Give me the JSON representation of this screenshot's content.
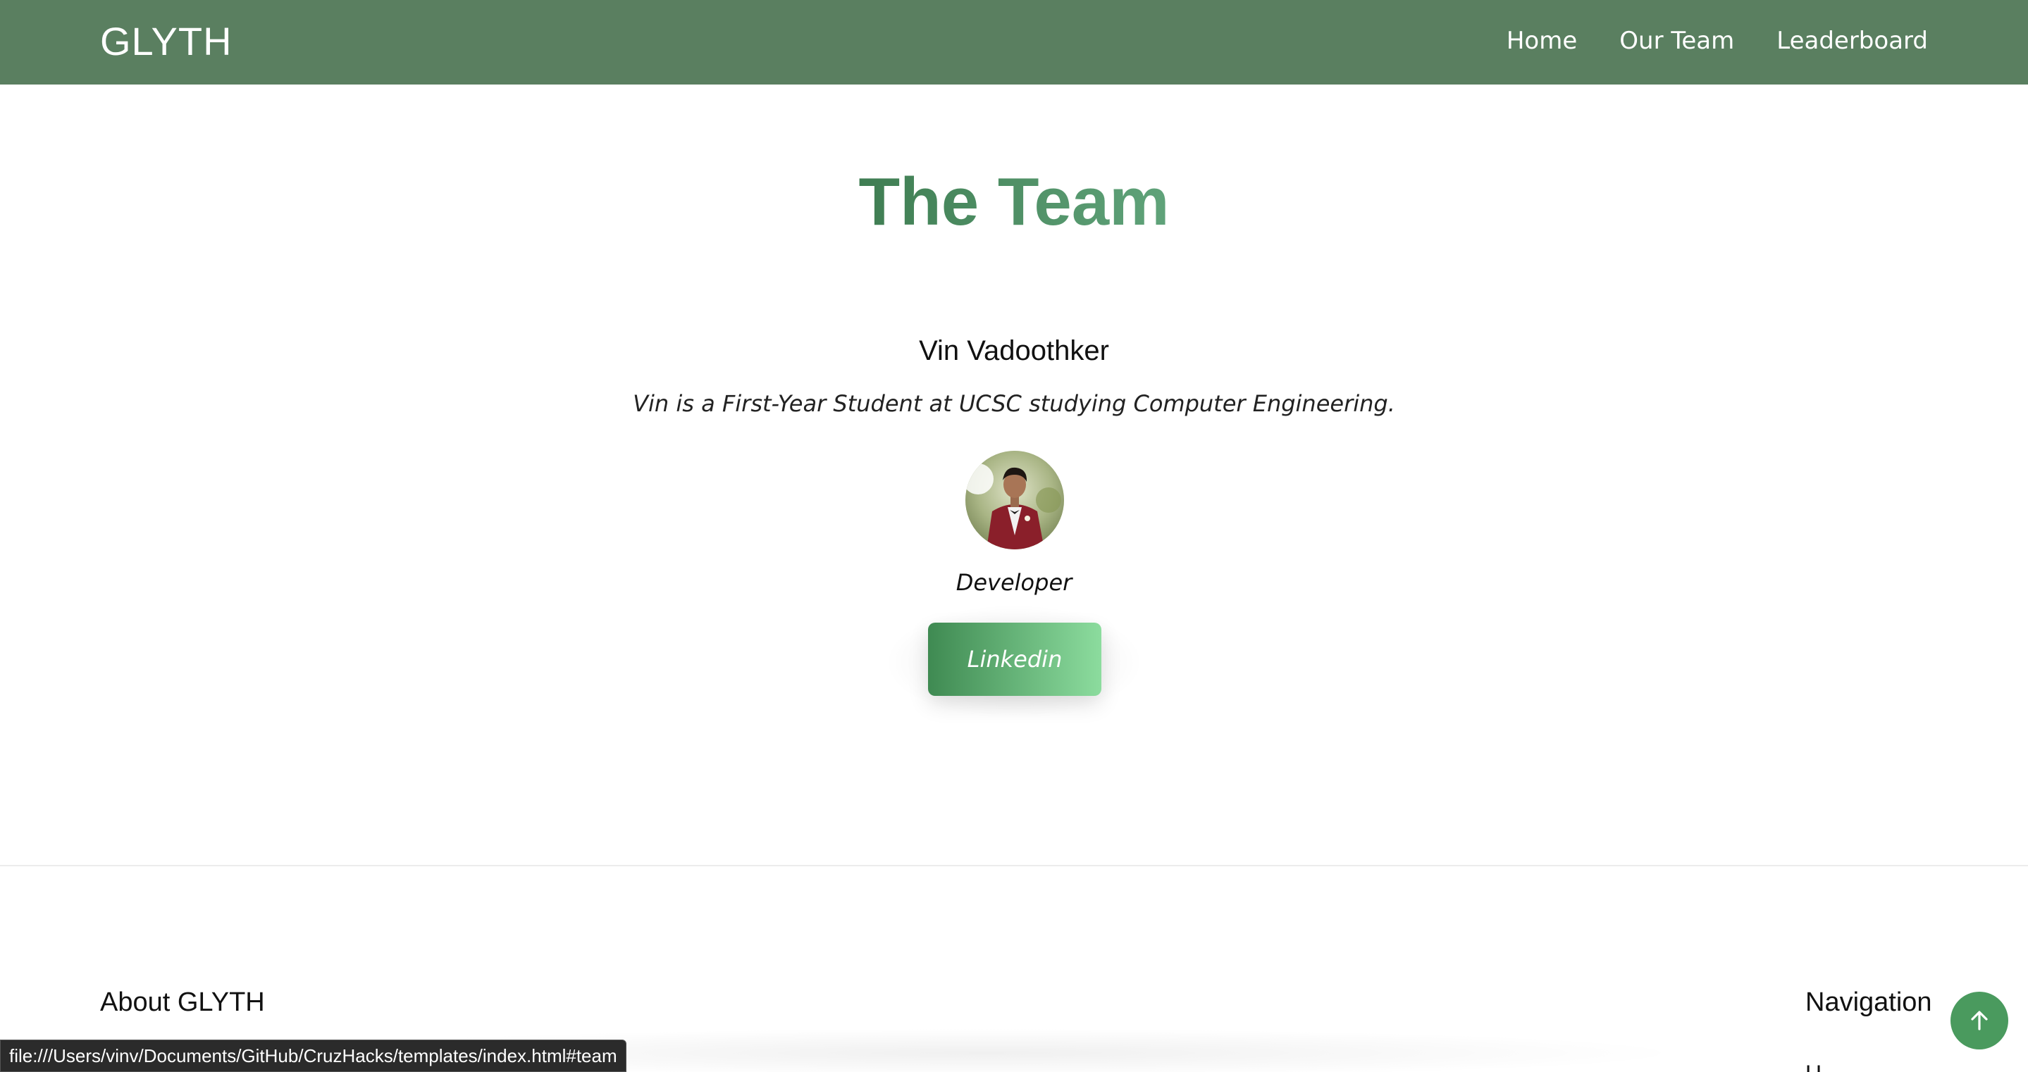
{
  "header": {
    "brand": "GLYTH",
    "nav": [
      {
        "label": "Home"
      },
      {
        "label": "Our Team"
      },
      {
        "label": "Leaderboard"
      }
    ]
  },
  "team": {
    "title": "The Team",
    "members": [
      {
        "name": "Vin Vadoothker",
        "bio": "Vin is a First-Year Student at UCSC studying Computer Engineering.",
        "role": "Developer",
        "linkedin_label": "Linkedin"
      }
    ]
  },
  "footer": {
    "about_heading": "About GLYTH",
    "nav_heading": "Navigation",
    "nav_first_item_partial": "H"
  },
  "status_bar": {
    "url": "file:///Users/vinv/Documents/GitHub/CruzHacks/templates/index.html#team"
  },
  "colors": {
    "header_bg": "#5a7f60",
    "title_gradient_start": "#3f7d52",
    "title_gradient_end": "#60a37a",
    "button_gradient_start": "#3f8a52",
    "button_gradient_end": "#8cdc9e",
    "scroll_top_bg": "#4a9a5e"
  },
  "icons": {
    "scroll_top": "arrow-up-icon"
  }
}
